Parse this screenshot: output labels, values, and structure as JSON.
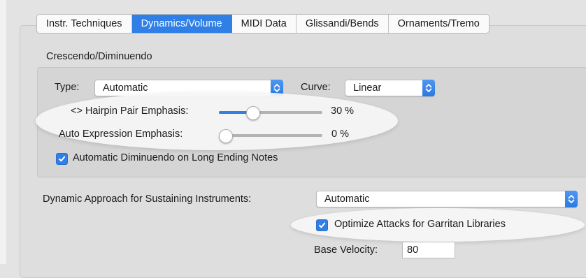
{
  "tabs": [
    {
      "label": "Instr. Techniques",
      "active": false
    },
    {
      "label": "Dynamics/Volume",
      "active": true
    },
    {
      "label": "MIDI Data",
      "active": false
    },
    {
      "label": "Glissandi/Bends",
      "active": false
    },
    {
      "label": "Ornaments/Tremo",
      "active": false
    }
  ],
  "crescendo": {
    "section_title": "Crescendo/Diminuendo",
    "type_label": "Type:",
    "type_value": "Automatic",
    "curve_label": "Curve:",
    "curve_value": "Linear",
    "hairpin_label": "<> Hairpin Pair Emphasis:",
    "hairpin_value": "30 %",
    "hairpin_fraction": 0.3,
    "auto_expr_label": "Auto Expression Emphasis:",
    "auto_expr_value": "0 %",
    "auto_expr_fraction": 0.0,
    "auto_dim_label": "Automatic Diminuendo on Long Ending Notes",
    "auto_dim_checked": true
  },
  "sustain": {
    "approach_label": "Dynamic Approach for Sustaining Instruments:",
    "approach_value": "Automatic",
    "optimize_label": "Optimize Attacks for Garritan Libraries",
    "optimize_checked": true,
    "base_velocity_label": "Base Velocity:",
    "base_velocity_value": "80"
  },
  "colors": {
    "accent": "#2f7fe6",
    "panel": "#dedede",
    "highlight": "#f6f6f6"
  },
  "icons": [
    "popup-stepper-icon",
    "checkmark-icon"
  ]
}
